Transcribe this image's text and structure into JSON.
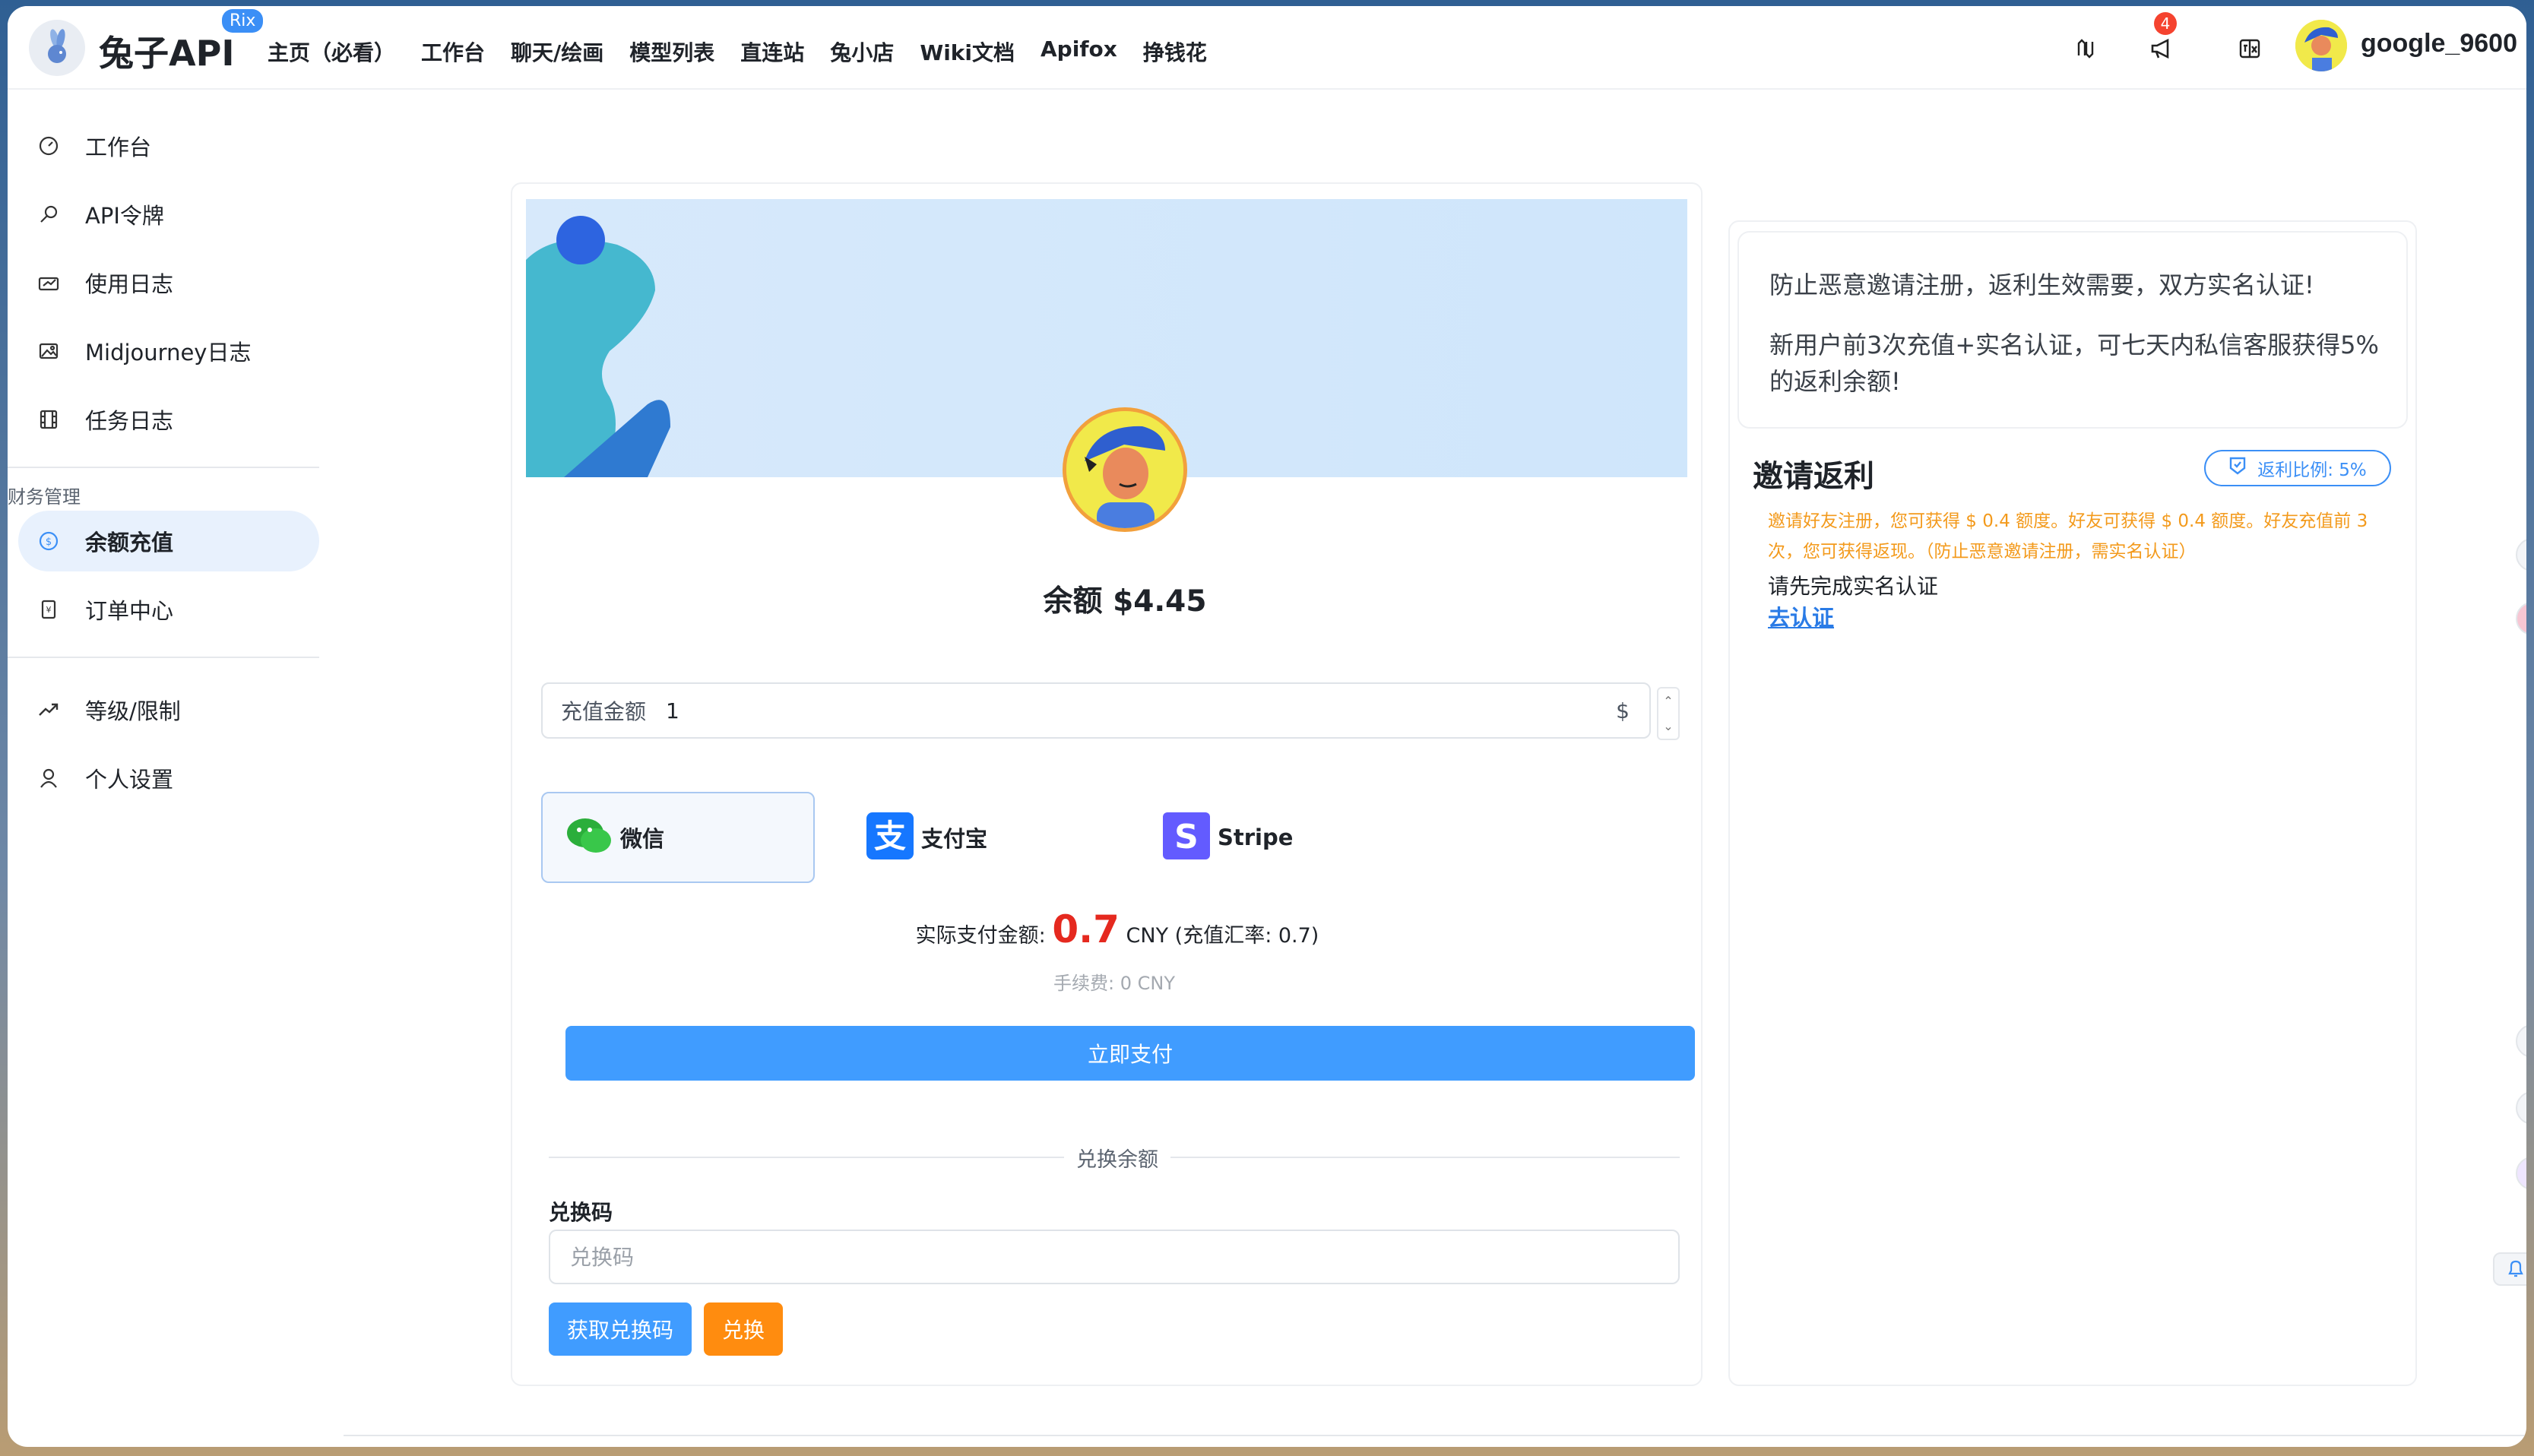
{
  "header": {
    "brand": "兔子API",
    "brand_badge": "Rix",
    "nav": [
      "主页（必看）",
      "工作台",
      "聊天/绘画",
      "模型列表",
      "直连站",
      "兔小店",
      "Wiki文档",
      "Apifox",
      "挣钱花"
    ],
    "notification_count": "4",
    "username": "google_9600",
    "icons": [
      "translate-icon",
      "megaphone-icon",
      "language-icon"
    ]
  },
  "sidebar": {
    "items": [
      {
        "label": "工作台",
        "icon": "dashboard-icon"
      },
      {
        "label": "API令牌",
        "icon": "key-icon"
      },
      {
        "label": "使用日志",
        "icon": "log-icon"
      },
      {
        "label": "Midjourney日志",
        "icon": "image-icon"
      },
      {
        "label": "任务日志",
        "icon": "film-icon"
      }
    ],
    "section_title": "财务管理",
    "finance_items": [
      {
        "label": "余额充值",
        "icon": "dollar-circle-icon",
        "active": true
      },
      {
        "label": "订单中心",
        "icon": "receipt-icon"
      }
    ],
    "other_items": [
      {
        "label": "等级/限制",
        "icon": "trend-icon"
      },
      {
        "label": "个人设置",
        "icon": "user-icon"
      }
    ]
  },
  "topup": {
    "balance_text": "余额 $4.45",
    "amount_label": "充值金额",
    "amount_value": "1",
    "amount_suffix": "$",
    "payment_methods": [
      {
        "name": "微信",
        "icon": "wechat-icon",
        "selected": true
      },
      {
        "name": "支付宝",
        "icon": "alipay-icon"
      },
      {
        "name": "Stripe",
        "icon": "stripe-icon"
      }
    ],
    "actual_prefix": "实际支付金额:",
    "actual_amount": "0.7",
    "actual_suffix": "CNY (充值汇率: 0.7)",
    "fee_text": "手续费: 0 CNY",
    "pay_button": "立即支付"
  },
  "redeem": {
    "divider_text": "兑换余额",
    "code_label": "兑换码",
    "code_placeholder": "兑换码",
    "get_code_button": "获取兑换码",
    "redeem_button": "兑换"
  },
  "invite": {
    "notice_line1": "防止恶意邀请注册，返利生效需要，双方实名认证!",
    "notice_line2": "新用户前3次充值+实名认证，可七天内私信客服获得5%的返利余额!",
    "title": "邀请返利",
    "ratio_tag": "返利比例: 5%",
    "description": "邀请好友注册，您可获得 $ 0.4 额度。好友可获得 $ 0.4 额度。好友充值前 3 次，您可获得返现。（防止恶意邀请注册，需实名认证）",
    "verify_prompt": "请先完成实名认证",
    "verify_link": "去认证"
  },
  "colors": {
    "accent": "#409cff",
    "orange": "#ff8c0f",
    "danger": "#e5291f",
    "active_bg": "#e8f1fd"
  }
}
